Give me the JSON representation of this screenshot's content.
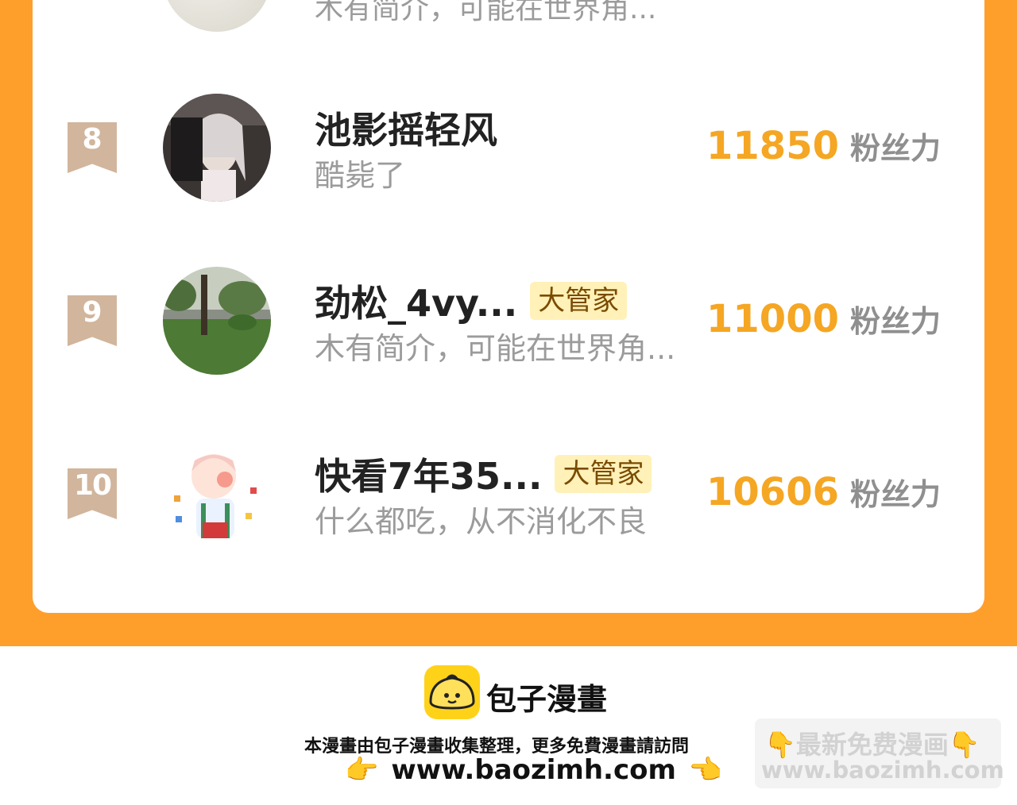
{
  "partial_row": {
    "desc": "木有简介，可能在世界角..."
  },
  "rows": [
    {
      "rank": "8",
      "name": "池影摇轻风",
      "badge": "",
      "desc": "酷毙了",
      "score": "11850",
      "score_label": "粉丝力"
    },
    {
      "rank": "9",
      "name": "劲松_4vy...",
      "badge": "大管家",
      "desc": "木有简介，可能在世界角...",
      "score": "11000",
      "score_label": "粉丝力"
    },
    {
      "rank": "10",
      "name": "快看7年35...",
      "badge": "大管家",
      "desc": "什么都吃，从不消化不良",
      "score": "10606",
      "score_label": "粉丝力"
    }
  ],
  "footer": {
    "brand": "包子漫畫",
    "note": "本漫畫由包子漫畫收集整理，更多免費漫畫請訪問",
    "url": "www.baozimh.com",
    "hand_left": "👉",
    "hand_right": "👈"
  },
  "watermark": {
    "line1": "👇最新免费漫画👇",
    "line2": "www.baozimh.com"
  },
  "colors": {
    "orange": "#ff9f2b",
    "score": "#f5a623",
    "rank_flag": "#d1b59c",
    "badge_bg": "#fff1b8"
  }
}
